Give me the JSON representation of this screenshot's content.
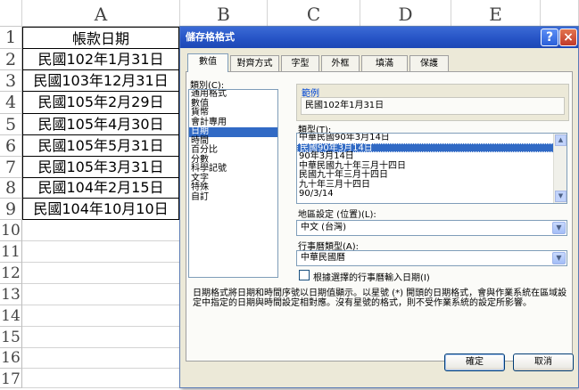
{
  "columns": [
    "A",
    "B",
    "C",
    "D",
    "E"
  ],
  "rows": [
    "1",
    "2",
    "3",
    "4",
    "5",
    "6",
    "7",
    "8",
    "9",
    "10",
    "11",
    "12",
    "13",
    "14",
    "15",
    "16",
    "17"
  ],
  "cells": {
    "header": "帳款日期",
    "values": [
      "民國102年1月31日",
      "民國103年12月31日",
      "民國105年2月29日",
      "民國105年4月30日",
      "民國105年5月31日",
      "民國105年3月31日",
      "民國104年2月15日",
      "民國104年10月10日"
    ]
  },
  "dialog": {
    "title": "儲存格格式",
    "help_label": "?",
    "close_label": "×",
    "tabs": [
      "數值",
      "對齊方式",
      "字型",
      "外框",
      "填滿",
      "保護"
    ],
    "category_label": "類別(C):",
    "categories": [
      "通用格式",
      "數值",
      "貨幣",
      "會計專用",
      "日期",
      "時間",
      "百分比",
      "分數",
      "科學記號",
      "文字",
      "特殊",
      "自訂"
    ],
    "selected_category": "日期",
    "sample_label": "範例",
    "sample_value": "民國102年1月31日",
    "type_label": "類型(T):",
    "types": [
      "中華民國90年3月14日",
      "民國90年3月14日",
      "90年3月14日",
      "中華民國九十年三月十四日",
      "民國九十年三月十四日",
      "九十年三月十四日",
      "90/3/14"
    ],
    "selected_type": "民國90年3月14日",
    "locale_label": "地區設定 (位置)(L):",
    "locale_value": "中文 (台灣)",
    "calendar_label": "行事曆類型(A):",
    "calendar_value": "中華民國曆",
    "checkbox_label": "根據選擇的行事曆輸入日期(I)",
    "description": "日期格式將日期和時間序號以日期值顯示。以星號 (*) 開頭的日期格式，會與作業系統在區域設定中指定的日期與時間設定相對應。沒有星號的格式，則不受作業系統的設定所影響。",
    "ok_label": "確定",
    "cancel_label": "取消"
  },
  "colors": {
    "title_bar": "#2552c4",
    "selection": "#316ac5",
    "dialog_bg": "#ece9d8"
  }
}
